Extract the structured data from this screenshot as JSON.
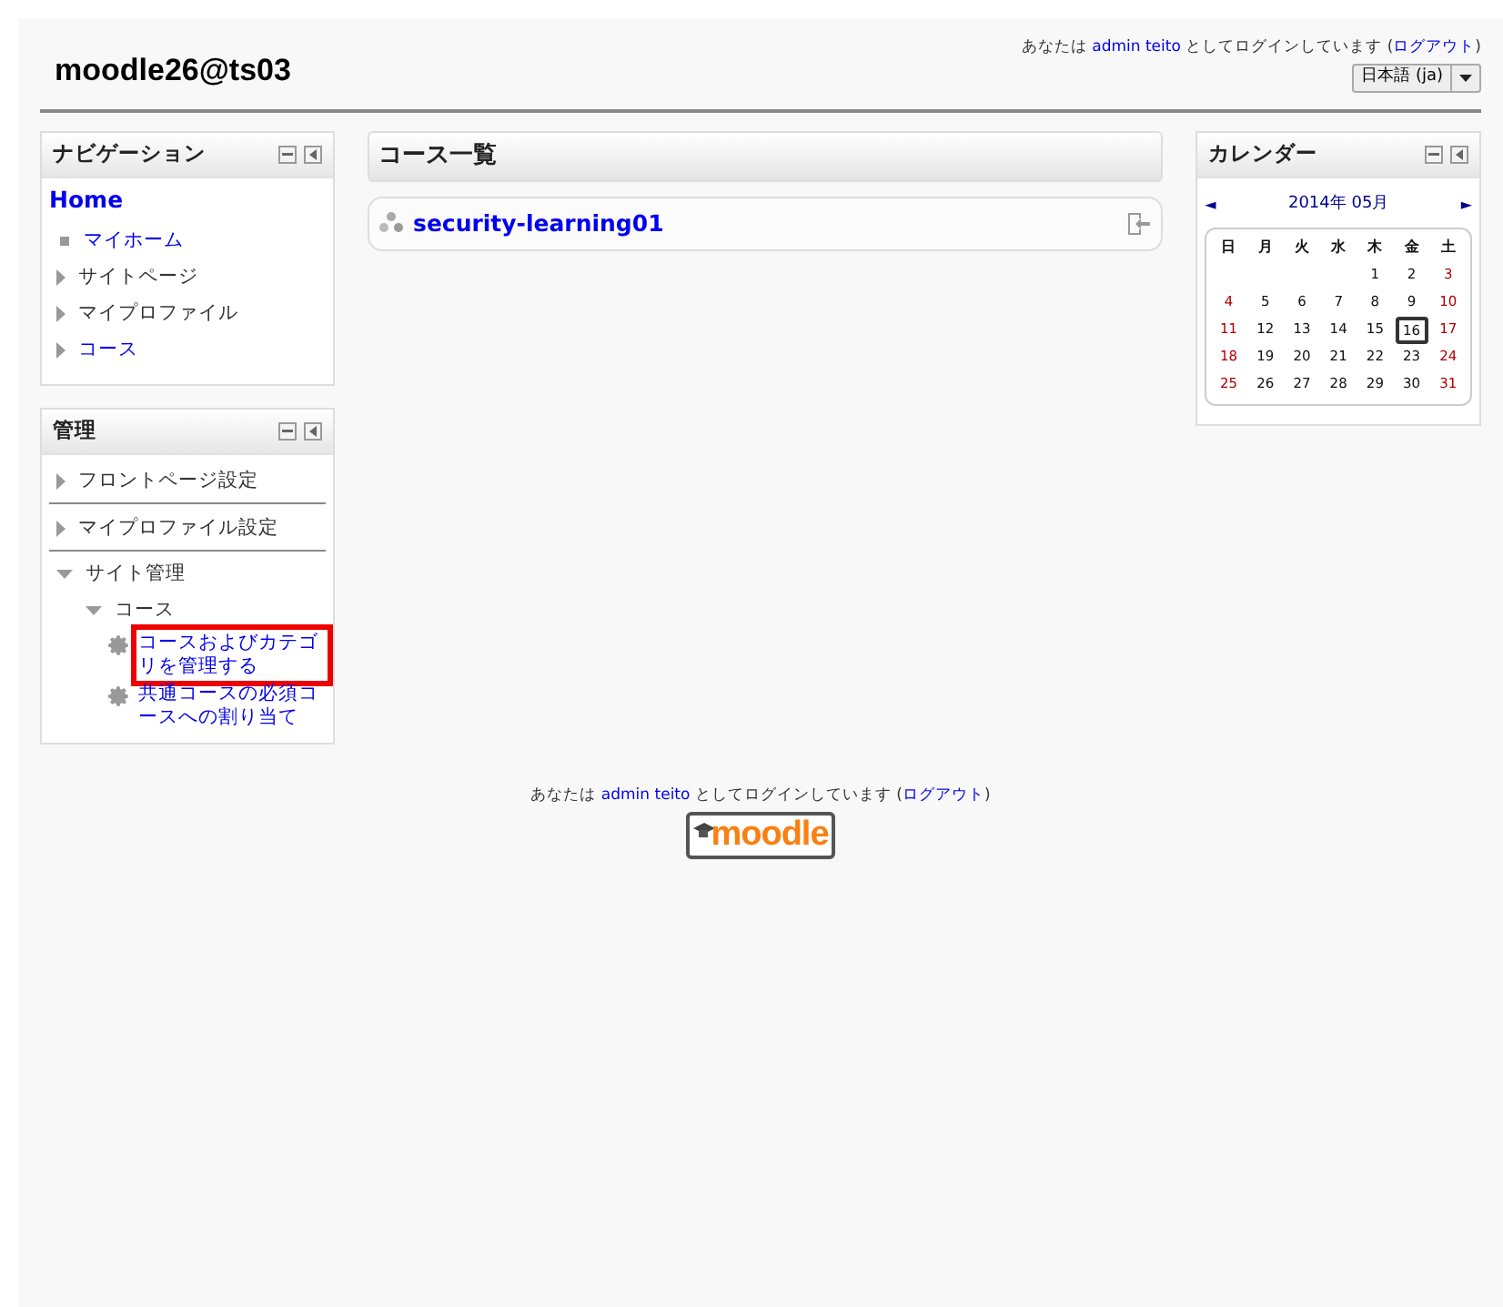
{
  "header": {
    "site_title": "moodle26@ts03",
    "login_info": {
      "prefix": "あなたは",
      "user": "admin teito",
      "middle": "としてログインしています (",
      "logout": "ログアウト",
      "suffix": ")"
    },
    "language": "日本語 (ja)"
  },
  "navigation": {
    "title": "ナビゲーション",
    "items": [
      {
        "label": "Home",
        "kind": "home",
        "link": true
      },
      {
        "label": "マイホーム",
        "kind": "leaf",
        "link": true
      },
      {
        "label": "サイトページ",
        "kind": "branch",
        "link": false,
        "expanded": false
      },
      {
        "label": "マイプロファイル",
        "kind": "branch",
        "link": false,
        "expanded": false
      },
      {
        "label": "コース",
        "kind": "branch",
        "link": true,
        "expanded": false
      }
    ]
  },
  "administration": {
    "title": "管理",
    "items": [
      {
        "label": "フロントページ設定",
        "kind": "branch",
        "expanded": false,
        "separator": true
      },
      {
        "label": "マイプロファイル設定",
        "kind": "branch",
        "expanded": false,
        "separator": true
      },
      {
        "label": "サイト管理",
        "kind": "branch",
        "expanded": true,
        "separator": false,
        "children": [
          {
            "label": "コース",
            "kind": "branch",
            "expanded": true,
            "separator": false,
            "children": [
              {
                "label": "コースおよびカテゴリを管理する",
                "kind": "setting",
                "separator": false,
                "highlighted": true
              },
              {
                "label": "共通コースの必須コースへの割り当て",
                "kind": "setting",
                "separator": false,
                "highlighted": false
              }
            ]
          }
        ]
      }
    ]
  },
  "course_list": {
    "title": "コース一覧",
    "courses": [
      {
        "name": "security-learning01"
      }
    ]
  },
  "calendar": {
    "title": "カレンダー",
    "prev": "◄",
    "month": "2014年 05月",
    "next": "►",
    "weekdays": [
      {
        "label": "日"
      },
      {
        "label": "月"
      },
      {
        "label": "火"
      },
      {
        "label": "水"
      },
      {
        "label": "木"
      },
      {
        "label": "金"
      },
      {
        "label": "土"
      }
    ],
    "weeks": [
      [
        {
          "day": "1",
          "weekend": false,
          "today": false
        },
        {
          "day": "2",
          "weekend": false,
          "today": false
        },
        {
          "day": "3",
          "weekend": true,
          "today": false
        }
      ],
      [
        {
          "day": "4",
          "weekend": true,
          "today": false
        },
        {
          "day": "5",
          "weekend": false,
          "today": false
        },
        {
          "day": "6",
          "weekend": false,
          "today": false
        },
        {
          "day": "7",
          "weekend": false,
          "today": false
        },
        {
          "day": "8",
          "weekend": false,
          "today": false
        },
        {
          "day": "9",
          "weekend": false,
          "today": false
        },
        {
          "day": "10",
          "weekend": true,
          "today": false
        }
      ],
      [
        {
          "day": "11",
          "weekend": true,
          "today": false
        },
        {
          "day": "12",
          "weekend": false,
          "today": false
        },
        {
          "day": "13",
          "weekend": false,
          "today": false
        },
        {
          "day": "14",
          "weekend": false,
          "today": false
        },
        {
          "day": "15",
          "weekend": false,
          "today": false
        },
        {
          "day": "16",
          "weekend": false,
          "today": true
        },
        {
          "day": "17",
          "weekend": true,
          "today": false
        }
      ],
      [
        {
          "day": "18",
          "weekend": true,
          "today": false
        },
        {
          "day": "19",
          "weekend": false,
          "today": false
        },
        {
          "day": "20",
          "weekend": false,
          "today": false
        },
        {
          "day": "21",
          "weekend": false,
          "today": false
        },
        {
          "day": "22",
          "weekend": false,
          "today": false
        },
        {
          "day": "23",
          "weekend": false,
          "today": false
        },
        {
          "day": "24",
          "weekend": true,
          "today": false
        }
      ],
      [
        {
          "day": "25",
          "weekend": true,
          "today": false
        },
        {
          "day": "26",
          "weekend": false,
          "today": false
        },
        {
          "day": "27",
          "weekend": false,
          "today": false
        },
        {
          "day": "28",
          "weekend": false,
          "today": false
        },
        {
          "day": "29",
          "weekend": false,
          "today": false
        },
        {
          "day": "30",
          "weekend": false,
          "today": false
        },
        {
          "day": "31",
          "weekend": true,
          "today": false
        }
      ]
    ]
  },
  "footer": {
    "login_info": {
      "prefix": "あなたは",
      "user": "admin teito",
      "middle": "としてログインしています (",
      "logout": "ログアウト",
      "suffix": ")"
    },
    "logo": "moodle"
  }
}
